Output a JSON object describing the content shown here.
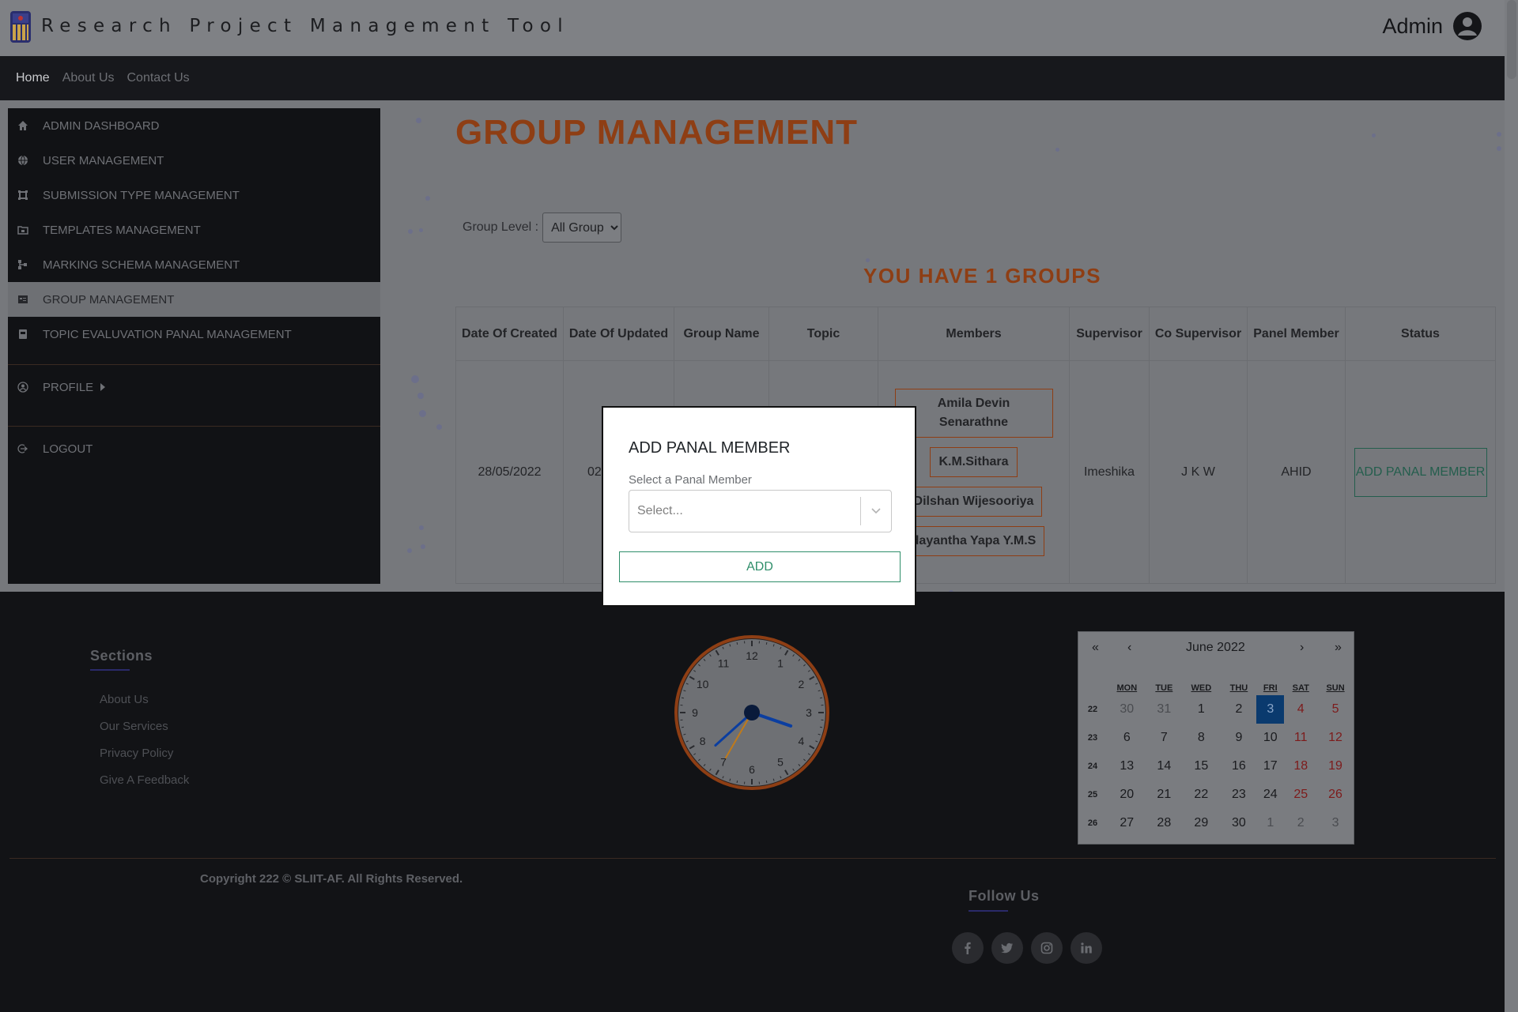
{
  "header": {
    "app_title": "Research Project Management Tool",
    "user_name": "Admin"
  },
  "nav": {
    "links": [
      "Home",
      "About Us",
      "Contact Us"
    ]
  },
  "sidebar": {
    "items": [
      {
        "label": "ADMIN DASHBOARD",
        "icon": "home-icon"
      },
      {
        "label": "USER MANAGEMENT",
        "icon": "globe-icon"
      },
      {
        "label": "SUBMISSION TYPE MANAGEMENT",
        "icon": "submission-icon"
      },
      {
        "label": "TEMPLATES MANAGEMENT",
        "icon": "template-icon"
      },
      {
        "label": "MARKING SCHEMA MANAGEMENT",
        "icon": "schema-icon"
      },
      {
        "label": "GROUP MANAGEMENT",
        "icon": "group-icon",
        "active": true
      },
      {
        "label": "TOPIC EVALUVATION PANAL MANAGEMENT",
        "icon": "clipboard-icon"
      },
      {
        "label": "PROFILE",
        "icon": "profile-icon"
      },
      {
        "label": "LOGOUT",
        "icon": "logout-icon"
      }
    ]
  },
  "main": {
    "title": "GROUP MANAGEMENT",
    "filter_label": "Group Level :",
    "filter_value": "All Group",
    "groups_count_text": "YOU HAVE 1 GROUPS",
    "table": {
      "headers": [
        "Date Of Created",
        "Date Of Updated",
        "Group Name",
        "Topic",
        "Members",
        "Supervisor",
        "Co Supervisor",
        "Panel Member",
        "Status"
      ],
      "row": {
        "created": "28/05/2022",
        "updated": "02",
        "group_name": "",
        "topic": "",
        "members": [
          "Amila Devin Senarathne",
          "K.M.Sithara",
          "Dilshan Wijesooriya",
          "dayantha Yapa Y.M.S"
        ],
        "supervisor": "Imeshika",
        "co_supervisor": "J K W",
        "panel_member": "AHID",
        "status_button": "ADD PANAL MEMBER"
      }
    }
  },
  "modal": {
    "title": "ADD PANAL MEMBER",
    "field_label": "Select a Panal Member",
    "placeholder": "Select...",
    "add_button": "ADD"
  },
  "footer": {
    "sections_title": "Sections",
    "sections": [
      "About Us",
      "Our Services",
      "Privacy Policy",
      "Give A Feedback"
    ],
    "copyright": "Copyright 222 © SLIIT-AF. All Rights Reserved.",
    "follow_title": "Follow Us",
    "socials": [
      "facebook-icon",
      "twitter-icon",
      "instagram-icon",
      "linkedin-icon"
    ],
    "clock": {
      "hour": 3,
      "minute": 38,
      "second": 35,
      "numbers": [
        "12",
        "1",
        "2",
        "3",
        "4",
        "5",
        "6",
        "7",
        "8",
        "9",
        "10",
        "11"
      ]
    },
    "calendar": {
      "month_label": "June 2022",
      "nav": [
        "«",
        "‹",
        "›",
        "»"
      ],
      "weekdays": [
        "MON",
        "TUE",
        "WED",
        "THU",
        "FRI",
        "SAT",
        "SUN"
      ],
      "weeks": [
        {
          "week": "22",
          "days": [
            "30",
            "31",
            "1",
            "2",
            "3",
            "4",
            "5"
          ]
        },
        {
          "week": "23",
          "days": [
            "6",
            "7",
            "8",
            "9",
            "10",
            "11",
            "12"
          ]
        },
        {
          "week": "24",
          "days": [
            "13",
            "14",
            "15",
            "16",
            "17",
            "18",
            "19"
          ]
        },
        {
          "week": "25",
          "days": [
            "20",
            "21",
            "22",
            "23",
            "24",
            "25",
            "26"
          ]
        },
        {
          "week": "26",
          "days": [
            "27",
            "28",
            "29",
            "30",
            "1",
            "2",
            "3"
          ]
        }
      ],
      "selected_day": "3"
    }
  },
  "colors": {
    "accent": "#8e3e14",
    "success": "#2f8e6a",
    "calendar_today": "#0a3a6e"
  }
}
